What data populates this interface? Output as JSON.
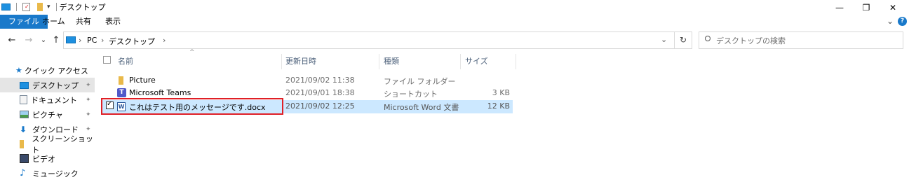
{
  "window": {
    "title": "デスクトップ",
    "controls": {
      "minimize": "—",
      "maximize": "❐",
      "close": "✕"
    }
  },
  "ribbon": {
    "tabs": [
      {
        "label": "ファイル",
        "active": true
      },
      {
        "label": "ホーム",
        "active": false
      },
      {
        "label": "共有",
        "active": false
      },
      {
        "label": "表示",
        "active": false
      }
    ],
    "expand": "⌄",
    "help": "?"
  },
  "nav": {
    "back": "←",
    "forward": "→",
    "recent": "⌄",
    "up": "↑",
    "breadcrumb": [
      "PC",
      "デスクトップ"
    ],
    "separator": "›",
    "dropdown": "⌄",
    "refresh": "↻",
    "search_placeholder": "デスクトップの検索"
  },
  "sidebar": {
    "items": [
      {
        "label": "クイック アクセス",
        "icon": "star-icon",
        "pinned": false,
        "selected": false
      },
      {
        "label": "デスクトップ",
        "icon": "desktop-icon",
        "pinned": true,
        "selected": true
      },
      {
        "label": "ドキュメント",
        "icon": "document-icon",
        "pinned": true,
        "selected": false
      },
      {
        "label": "ピクチャ",
        "icon": "pictures-icon",
        "pinned": true,
        "selected": false
      },
      {
        "label": "ダウンロード",
        "icon": "download-icon",
        "pinned": true,
        "selected": false
      },
      {
        "label": "スクリーンショット",
        "icon": "folder-icon",
        "pinned": false,
        "selected": false
      },
      {
        "label": "ビデオ",
        "icon": "video-icon",
        "pinned": false,
        "selected": false
      },
      {
        "label": "ミュージック",
        "icon": "music-icon",
        "pinned": false,
        "selected": false
      }
    ],
    "pin_glyph": "📌"
  },
  "columns": {
    "name": "名前",
    "modified": "更新日時",
    "type": "種類",
    "size": "サイズ",
    "sort_indicator": "^"
  },
  "files": [
    {
      "name": "Picture",
      "modified": "2021/09/02 11:38",
      "type": "ファイル フォルダー",
      "size": "",
      "icon": "folder-icon",
      "selected": false
    },
    {
      "name": "Microsoft Teams",
      "modified": "2021/09/01 18:38",
      "type": "ショートカット",
      "size": "3 KB",
      "icon": "teams-icon",
      "selected": false
    },
    {
      "name": "これはテスト用のメッセージです.docx",
      "modified": "2021/09/02 12:25",
      "type": "Microsoft Word 文書",
      "size": "12 KB",
      "icon": "word-icon",
      "selected": true
    }
  ],
  "colors": {
    "accent": "#1979ca",
    "selection": "#cce8ff",
    "highlight_box": "#e01f26",
    "folder": "#e9b94a"
  }
}
